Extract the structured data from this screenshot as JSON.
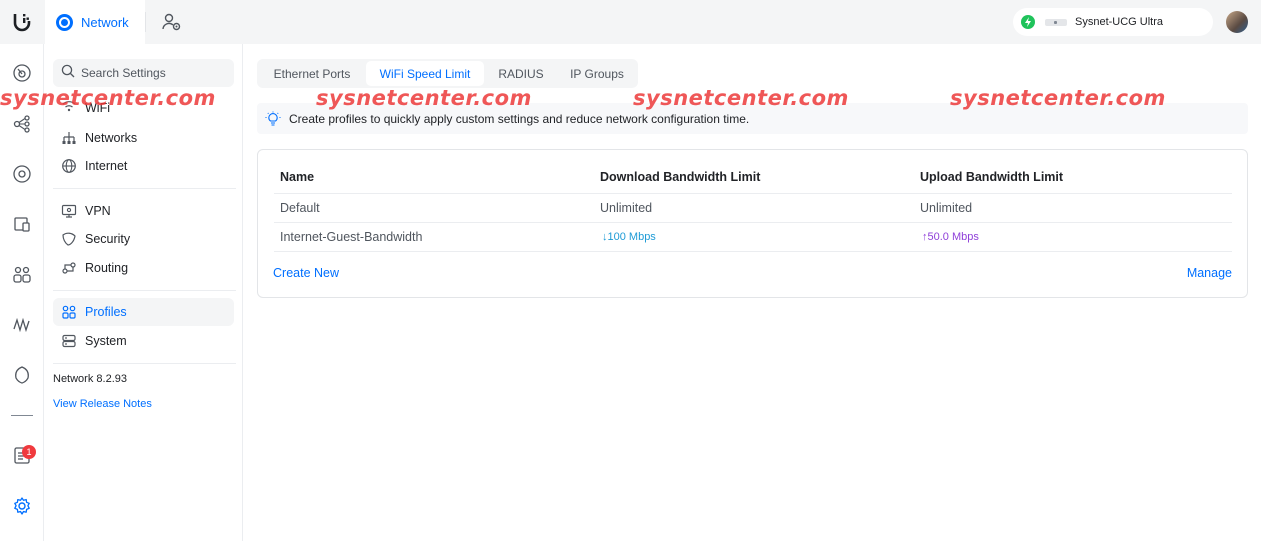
{
  "topbar": {
    "app_name": "Network",
    "device_name": "Sysnet-UCG Ultra"
  },
  "rail": {
    "notification_count": "1"
  },
  "sidebar": {
    "search_placeholder": "Search Settings",
    "items": [
      {
        "label": "WiFi",
        "icon": "wifi-icon"
      },
      {
        "label": "Networks",
        "icon": "networks-icon"
      },
      {
        "label": "Internet",
        "icon": "globe-icon"
      },
      {
        "label": "VPN",
        "icon": "vpn-icon"
      },
      {
        "label": "Security",
        "icon": "shield-icon"
      },
      {
        "label": "Routing",
        "icon": "routing-icon"
      },
      {
        "label": "Profiles",
        "icon": "profiles-icon",
        "active": true
      },
      {
        "label": "System",
        "icon": "system-icon"
      }
    ],
    "version": "Network 8.2.93",
    "release_notes": "View Release Notes"
  },
  "tabs": [
    {
      "label": "Ethernet Ports"
    },
    {
      "label": "WiFi Speed Limit",
      "active": true
    },
    {
      "label": "RADIUS"
    },
    {
      "label": "IP Groups"
    }
  ],
  "info_text": "Create profiles to quickly apply custom settings and reduce network configuration time.",
  "table": {
    "headers": [
      "Name",
      "Download Bandwidth Limit",
      "Upload Bandwidth Limit"
    ],
    "rows": [
      {
        "name": "Default",
        "download": "Unlimited",
        "upload": "Unlimited"
      },
      {
        "name": "Internet-Guest-Bandwidth",
        "download": "↓100 Mbps",
        "upload": "↑50.0 Mbps"
      }
    ],
    "create_label": "Create New",
    "manage_label": "Manage"
  },
  "watermark": "sysnetcenter.com",
  "colors": {
    "accent": "#006fff",
    "download": "#1e9bd6",
    "upload": "#8f3fd9",
    "status_online": "#1fc35b",
    "badge": "#f03a3e"
  }
}
